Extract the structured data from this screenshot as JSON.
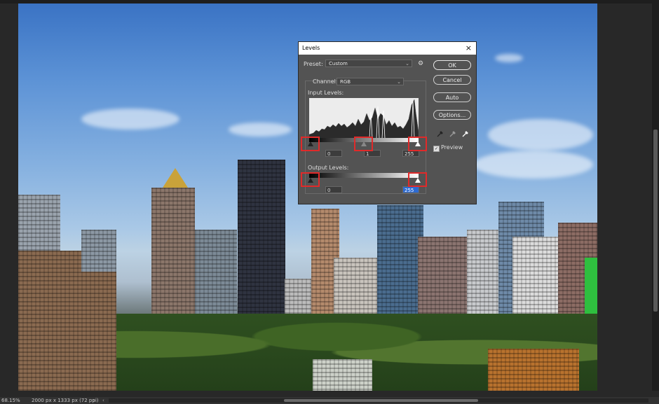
{
  "status": {
    "zoom": "68.15%",
    "document_info": "2000 px x 1333 px (72 ppi)",
    "nav_arrow": "›",
    "scroll_left_arrow": "‹"
  },
  "levels_dialog": {
    "title": "Levels",
    "close_label": "×",
    "preset_label": "Preset:",
    "preset_value": "Custom",
    "channel_label": "Channel:",
    "channel_value": "RGB",
    "input_levels_label": "Input Levels:",
    "input_black": "0",
    "input_gamma": "1",
    "input_white": "255",
    "output_levels_label": "Output Levels:",
    "output_black": "0",
    "output_white": "255",
    "buttons": {
      "ok": "OK",
      "cancel": "Cancel",
      "auto": "Auto",
      "options": "Options..."
    },
    "preview_label": "Preview",
    "preview_checked": "✓",
    "gear_icon": "⚙",
    "caret_icon": "⌄"
  },
  "colors": {
    "highlight_box": "#e02a2a",
    "selection": "#2d6bd2"
  }
}
